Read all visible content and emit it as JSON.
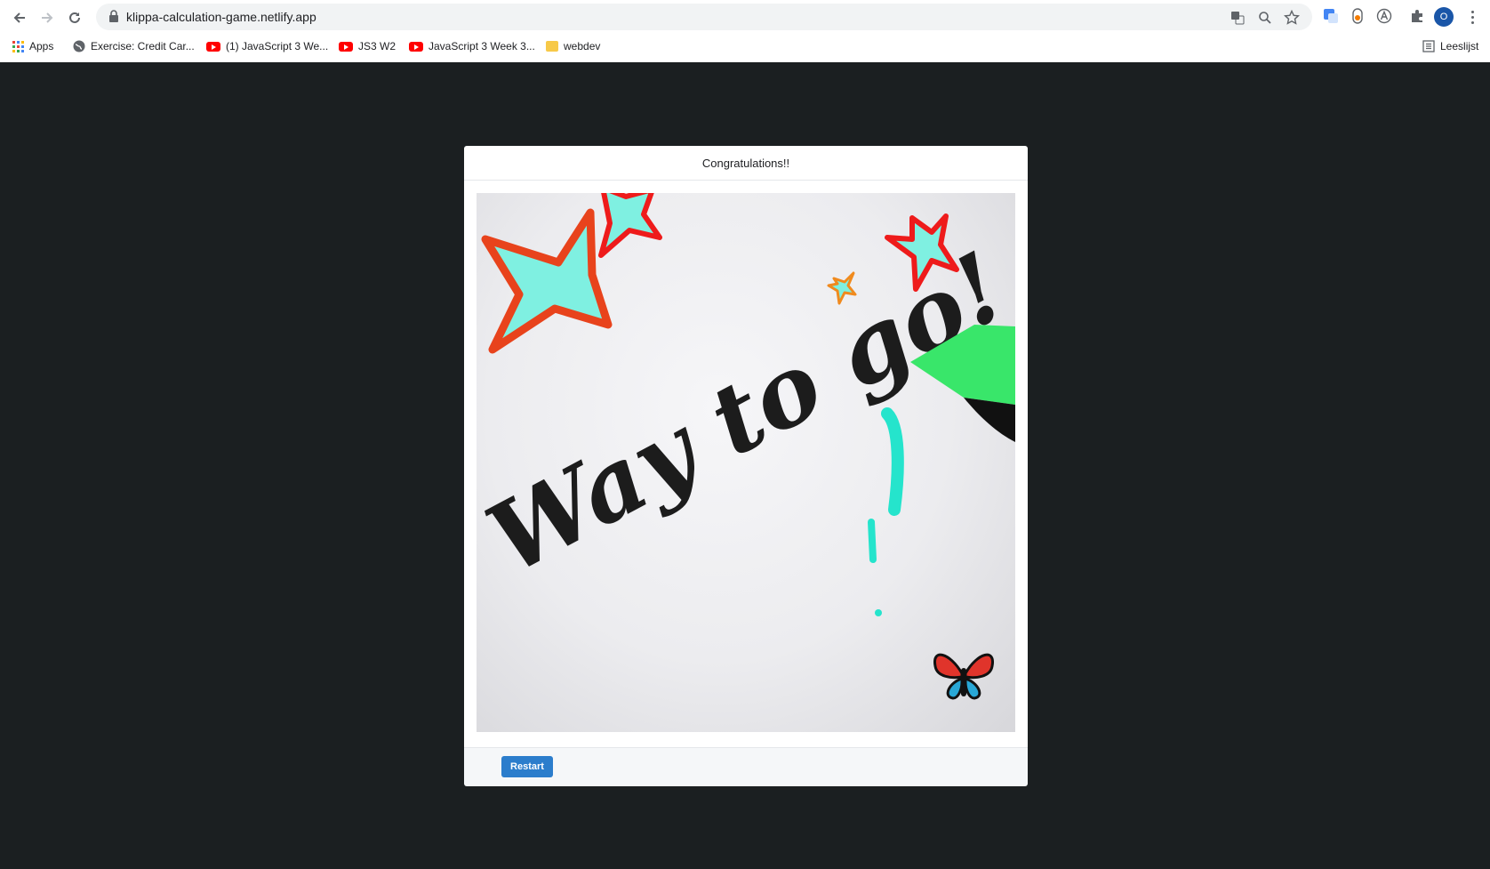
{
  "browser": {
    "url": "klippa-calculation-game.netlify.app",
    "bookmarks": [
      {
        "label": "Apps",
        "icon": "apps-grid-icon"
      },
      {
        "label": "Exercise: Credit Car...",
        "icon": "globe-icon"
      },
      {
        "label": "(1) JavaScript 3 We...",
        "icon": "youtube-icon"
      },
      {
        "label": "JS3 W2",
        "icon": "youtube-icon"
      },
      {
        "label": "JavaScript 3 Week 3...",
        "icon": "youtube-icon"
      },
      {
        "label": "webdev",
        "icon": "folder-icon"
      }
    ],
    "reading_list_label": "Leeslijst",
    "avatar_initial": "O"
  },
  "modal": {
    "title": "Congratulations!!",
    "image_text": "Way to go!",
    "restart_label": "Restart"
  },
  "colors": {
    "page_bg": "#1b1f21",
    "accent": "#2b7dcc",
    "star_fill": "#7ff0e1",
    "star_outline": "#e8341c",
    "marker": "#39e66a"
  }
}
